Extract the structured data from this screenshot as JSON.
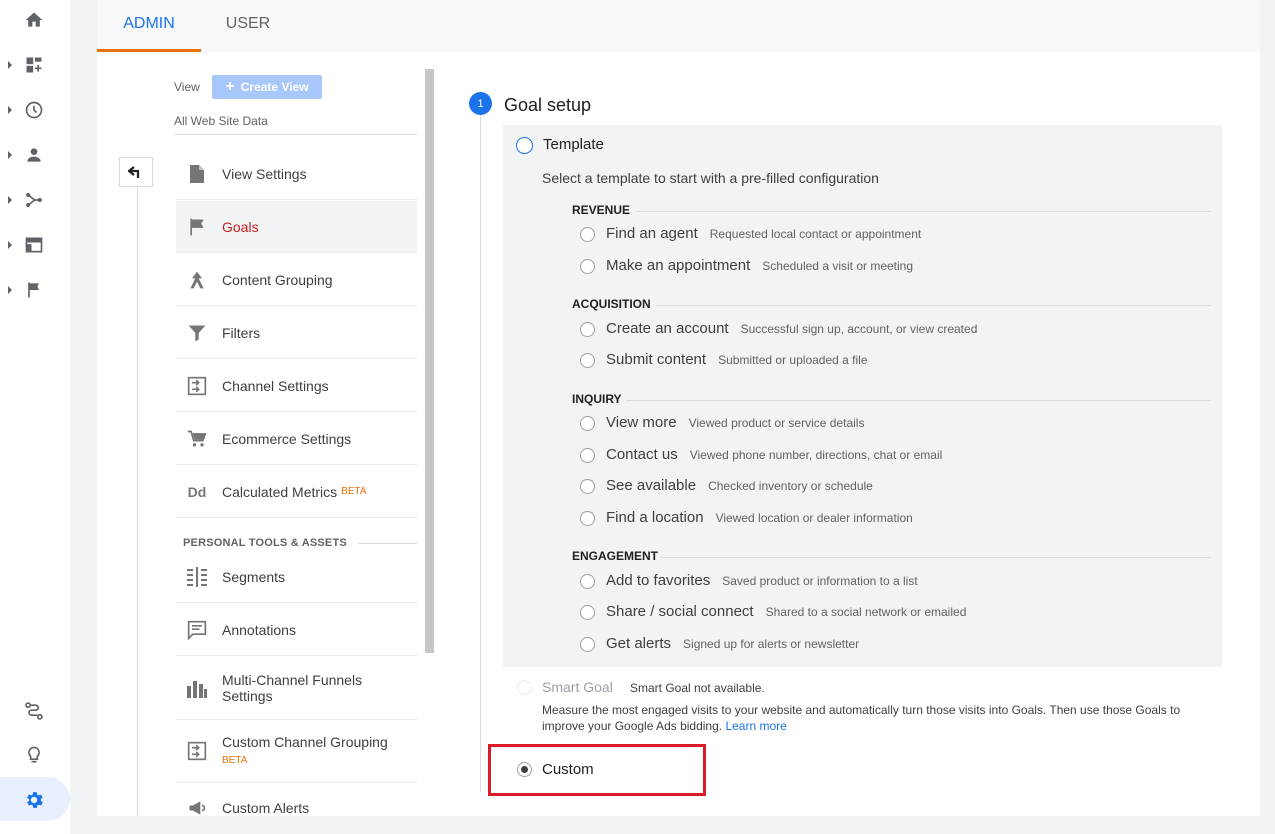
{
  "tabs": [
    {
      "label": "ADMIN"
    },
    {
      "label": "USER"
    }
  ],
  "view": {
    "label": "View",
    "create_view_label": "Create View",
    "site_data": "All Web Site Data"
  },
  "menu": {
    "items": [
      {
        "label": "View Settings",
        "icon": "page-icon"
      },
      {
        "label": "Goals",
        "icon": "flag-icon"
      },
      {
        "label": "Content Grouping",
        "icon": "grouping-icon"
      },
      {
        "label": "Filters",
        "icon": "filter-icon"
      },
      {
        "label": "Channel Settings",
        "icon": "channel-icon"
      },
      {
        "label": "Ecommerce Settings",
        "icon": "cart-icon"
      },
      {
        "label": "Calculated Metrics",
        "icon": "dd-icon",
        "badge": "BETA"
      },
      {
        "label": "Segments",
        "icon": "segments-icon"
      },
      {
        "label": "Annotations",
        "icon": "annotation-icon"
      },
      {
        "label": "Multi-Channel Funnels",
        "label2": "Settings",
        "icon": "bars-icon"
      },
      {
        "label": "Custom Channel Grouping",
        "icon": "channel-icon",
        "badge": "BETA"
      },
      {
        "label": "Custom Alerts",
        "icon": "megaphone-icon"
      }
    ],
    "section_head": "PERSONAL TOOLS & ASSETS"
  },
  "goal_setup": {
    "step_number": "1",
    "title": "Goal setup",
    "template_label": "Template",
    "template_desc": "Select a template to start with a pre-filled configuration",
    "categories": [
      {
        "name": "REVENUE",
        "options": [
          {
            "label": "Find an agent",
            "desc": "Requested local contact or appointment"
          },
          {
            "label": "Make an appointment",
            "desc": "Scheduled a visit or meeting"
          }
        ]
      },
      {
        "name": "ACQUISITION",
        "options": [
          {
            "label": "Create an account",
            "desc": "Successful sign up, account, or view created"
          },
          {
            "label": "Submit content",
            "desc": "Submitted or uploaded a file"
          }
        ]
      },
      {
        "name": "INQUIRY",
        "options": [
          {
            "label": "View more",
            "desc": "Viewed product or service details"
          },
          {
            "label": "Contact us",
            "desc": "Viewed phone number, directions, chat or email"
          },
          {
            "label": "See available",
            "desc": "Checked inventory or schedule"
          },
          {
            "label": "Find a location",
            "desc": "Viewed location or dealer information"
          }
        ]
      },
      {
        "name": "ENGAGEMENT",
        "options": [
          {
            "label": "Add to favorites",
            "desc": "Saved product or information to a list"
          },
          {
            "label": "Share / social connect",
            "desc": "Shared to a social network or emailed"
          },
          {
            "label": "Get alerts",
            "desc": "Signed up for alerts or newsletter"
          }
        ]
      }
    ],
    "smart_goal_label": "Smart Goal",
    "smart_goal_status": "Smart Goal not available.",
    "smart_goal_desc": "Measure the most engaged visits to your website and automatically turn those visits into Goals. Then use those Goals to improve your Google Ads bidding.",
    "learn_more": "Learn more",
    "custom_label": "Custom",
    "selected": "Custom"
  },
  "colors": {
    "accent": "#1a73e8",
    "tab_underline": "#e8710a",
    "active_menu_text": "#c5221f",
    "highlight_border": "#d81b24"
  }
}
